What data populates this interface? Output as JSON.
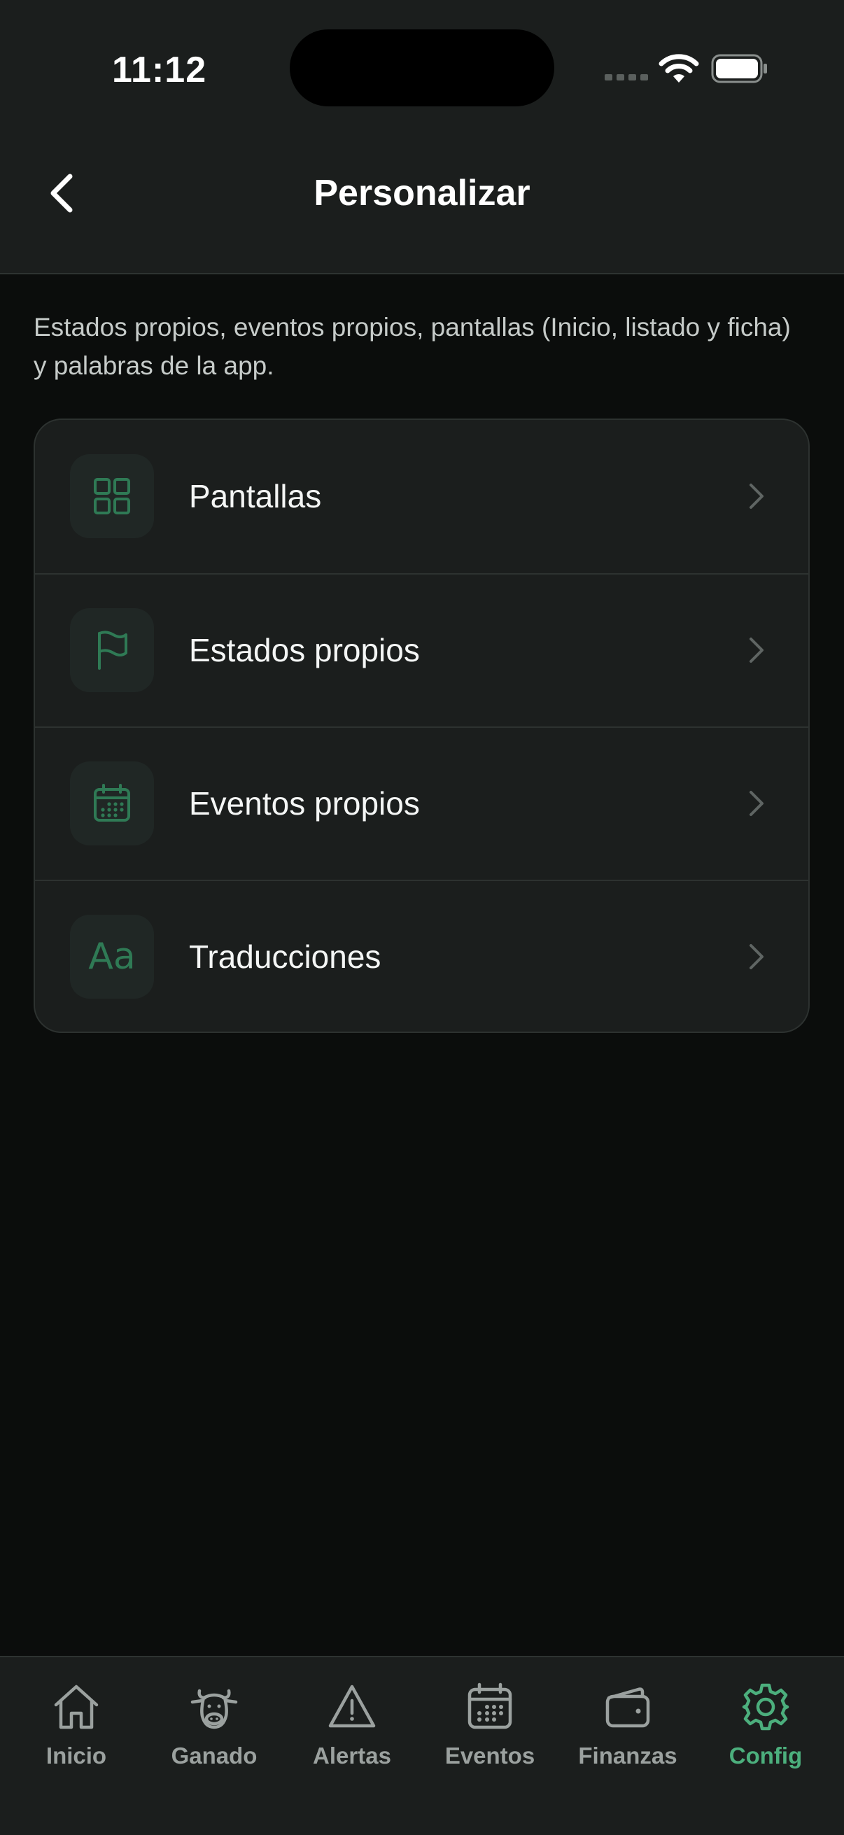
{
  "status_bar": {
    "time": "11:12"
  },
  "header": {
    "title": "Personalizar"
  },
  "description": "Estados propios, eventos propios, pantallas (Inicio, listado y ficha) y palabras de la app.",
  "menu": {
    "items": [
      {
        "label": "Pantallas",
        "icon": "grid-icon"
      },
      {
        "label": "Estados propios",
        "icon": "flag-icon"
      },
      {
        "label": "Eventos propios",
        "icon": "calendar-icon"
      },
      {
        "label": "Traducciones",
        "icon": "text-aa-icon",
        "glyph": "Aa"
      }
    ]
  },
  "tabbar": {
    "tabs": [
      {
        "label": "Inicio",
        "icon": "home-icon"
      },
      {
        "label": "Ganado",
        "icon": "cow-icon"
      },
      {
        "label": "Alertas",
        "icon": "warning-icon"
      },
      {
        "label": "Eventos",
        "icon": "calendar-icon"
      },
      {
        "label": "Finanzas",
        "icon": "wallet-icon"
      },
      {
        "label": "Config",
        "icon": "gear-icon",
        "active": true
      }
    ]
  },
  "colors": {
    "background": "#0b0d0c",
    "surface": "#1b1e1d",
    "accent": "#4caf7d",
    "icon_accent": "#2f7a55",
    "muted": "#9ba19f"
  }
}
